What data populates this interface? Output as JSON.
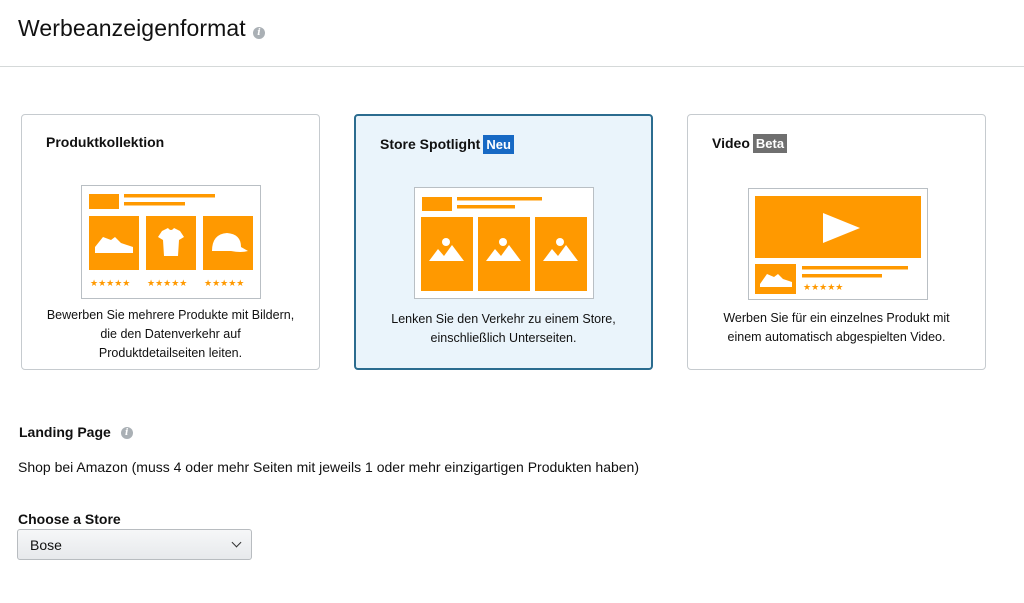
{
  "header": {
    "title": "Werbeanzeigenformat"
  },
  "cards": [
    {
      "title": "Produktkollektion",
      "badge": "",
      "description": [
        "Bewerben Sie mehrere Produkte mit Bildern,",
        "die den Datenverkehr auf",
        "Produktdetailseiten leiten."
      ],
      "selected": false
    },
    {
      "title": "Store Spotlight",
      "badge": "Neu",
      "description": [
        "Lenken Sie den Verkehr zu einem Store,",
        "einschließlich Unterseiten."
      ],
      "selected": true
    },
    {
      "title": "Video",
      "badge": "Beta",
      "description": [
        "Werben Sie für ein einzelnes Produkt mit",
        "einem automatisch abgespielten Video."
      ],
      "selected": false
    }
  ],
  "illustration": {
    "stars": "★★★★★"
  },
  "landing": {
    "label": "Landing Page",
    "text": "Shop bei Amazon (muss 4 oder mehr Seiten mit jeweils 1 oder mehr einzigartigen Produkten haben)"
  },
  "store_select": {
    "label": "Choose a Store",
    "value": "Bose"
  },
  "colors": {
    "accent": "#ff9900",
    "selected_border": "#2b6c8f",
    "selected_bg": "#eaf4fb",
    "badge_new": "#1769c4",
    "badge_beta": "#6f6f6f"
  }
}
